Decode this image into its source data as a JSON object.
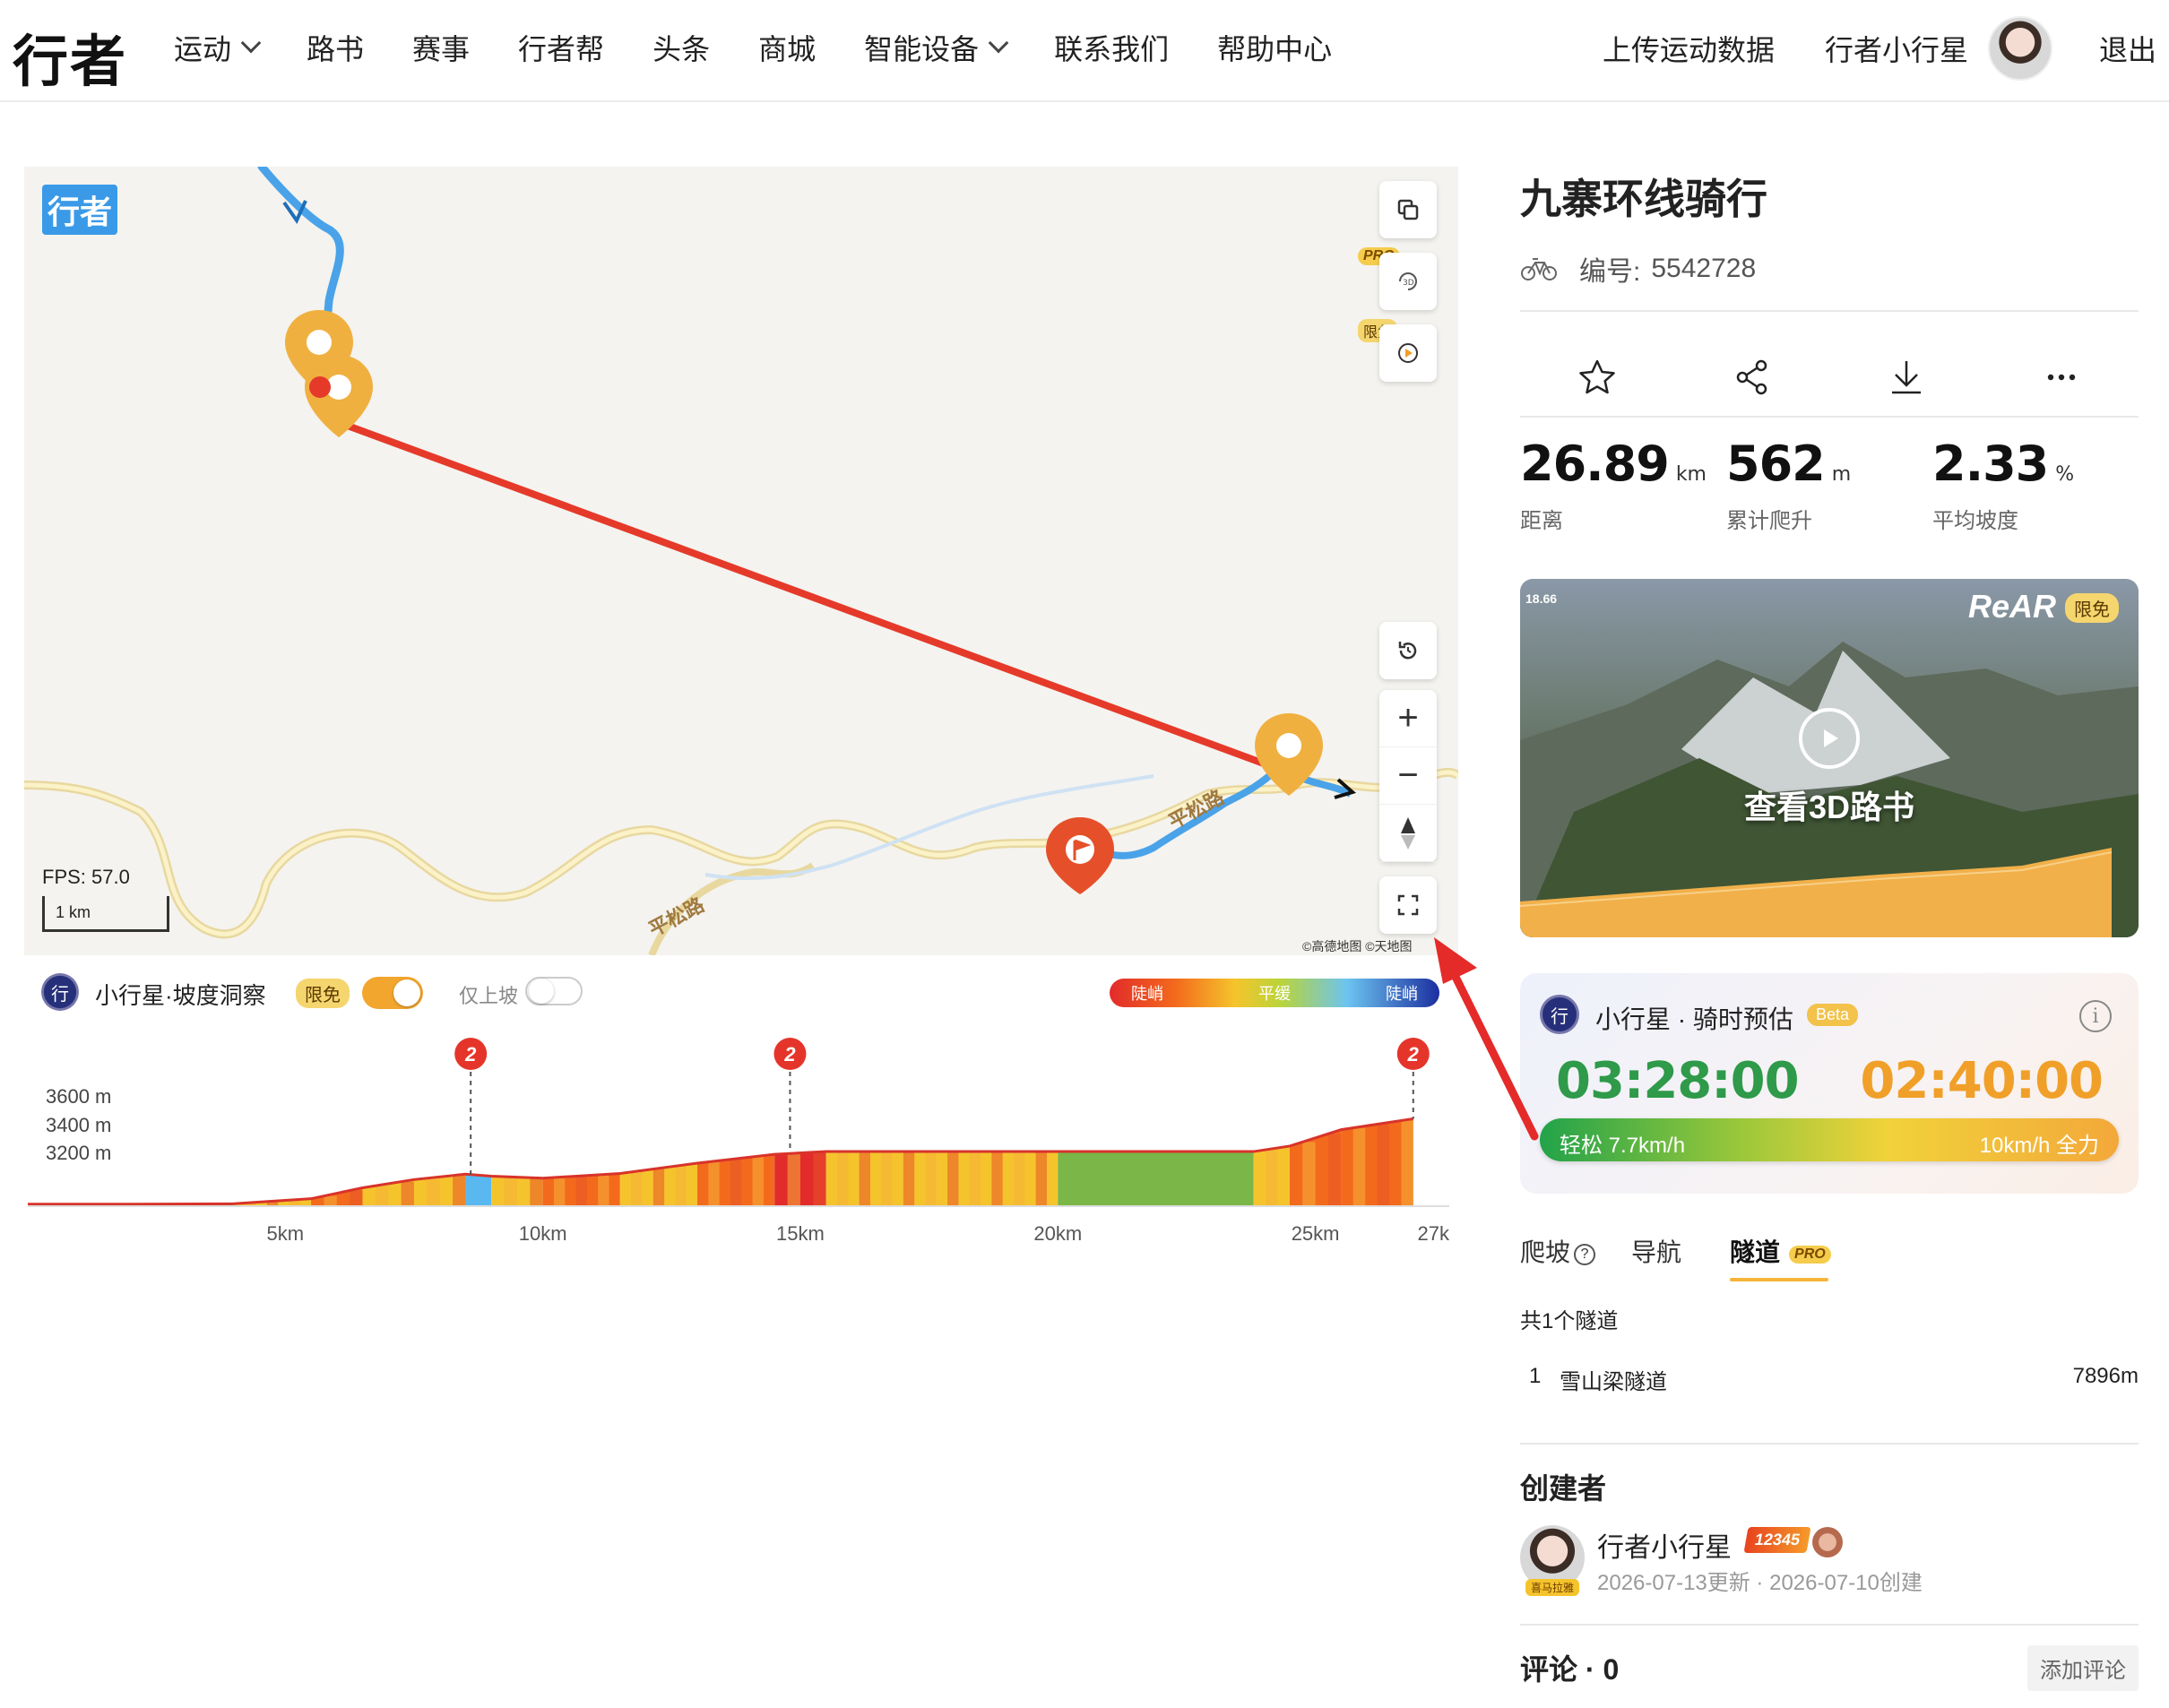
{
  "header": {
    "logo": "行者",
    "nav": [
      "运动",
      "路书",
      "赛事",
      "行者帮",
      "头条",
      "商城",
      "智能设备",
      "联系我们",
      "帮助中心"
    ],
    "upload": "上传运动数据",
    "username": "行者小行星",
    "logout": "退出"
  },
  "map": {
    "logo": "行者",
    "pro_tag": "PRO",
    "free_tag": "限免",
    "fps": "FPS: 57.0",
    "scale": "1 km",
    "attribution": "©高德地图  ©天地图",
    "road_label": "平松路"
  },
  "slope": {
    "title": "小行星·坡度洞察",
    "free_tag": "限免",
    "uphill_only": "仅上坡",
    "legend": [
      "陡峭",
      "平缓",
      "陡峭"
    ],
    "colors": {
      "steep": "#e22b2b",
      "mid": "#f5c42c",
      "flat": "#7ab648",
      "descent": "#5ab8f0"
    }
  },
  "chart_data": {
    "type": "area",
    "xlabel": "",
    "ylabel": "",
    "x_ticks": [
      "5km",
      "10km",
      "15km",
      "20km",
      "25km",
      "27k"
    ],
    "y_ticks": [
      "3600 m",
      "3400 m",
      "3200 m"
    ],
    "markers": [
      {
        "label": "2",
        "km": 8.6
      },
      {
        "label": "2",
        "km": 14.8
      },
      {
        "label": "2",
        "km": 26.9
      }
    ],
    "x": [
      0,
      2,
      4,
      5.5,
      6.5,
      7.5,
      8.5,
      9,
      10,
      11.5,
      13,
      14.5,
      15.5,
      20,
      23.8,
      24.5,
      25.5,
      26.9
    ],
    "elevation": [
      2795,
      2795,
      2798,
      2835,
      2915,
      2975,
      3015,
      3000,
      2985,
      3020,
      3095,
      3160,
      3180,
      3180,
      3180,
      3220,
      3340,
      3420
    ],
    "xlim": [
      0,
      27.6
    ]
  },
  "route": {
    "title": "九寨环线骑行",
    "id_label": "编号:",
    "id": "5542728",
    "stats": [
      {
        "value": "26.89",
        "unit": "km",
        "label": "距离"
      },
      {
        "value": "562",
        "unit": "m",
        "label": "累计爬升"
      },
      {
        "value": "2.33",
        "unit": "%",
        "label": "平均坡度"
      }
    ],
    "card3d": {
      "label": "查看3D路书",
      "brand": "ReAR",
      "free": "限免",
      "speed": "18.66"
    }
  },
  "estimate": {
    "title": "小行星 · 骑时预估",
    "beta": "Beta",
    "info": "i",
    "easy_time": "03:28:00",
    "hard_time": "02:40:00",
    "easy_label": "轻松 7.7km/h",
    "hard_label": "10km/h 全力"
  },
  "tabs": {
    "items": [
      "爬坡",
      "导航",
      "隧道"
    ],
    "help": "?",
    "pro": "PRO",
    "active": 2
  },
  "tunnels": {
    "count": "共1个隧道",
    "rows": [
      {
        "index": "1",
        "name": "雪山梁隧道",
        "length": "7896m"
      }
    ]
  },
  "creator": {
    "heading": "创建者",
    "name": "行者小行星",
    "level": "12345",
    "avatar_tag": "喜马拉雅",
    "meta": "2026-07-13更新 · 2026-07-10创建"
  },
  "comments": {
    "heading": "评论 · 0",
    "add": "添加评论"
  }
}
